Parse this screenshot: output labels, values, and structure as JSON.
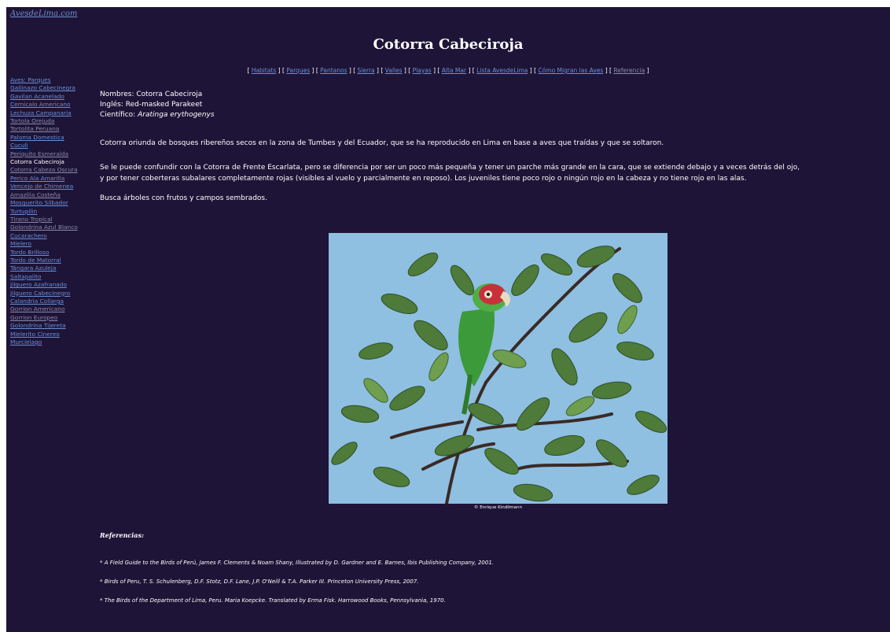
{
  "site": {
    "name": "AvesdeLima.com"
  },
  "page": {
    "title": "Cotorra Cabeciroja"
  },
  "topnav": {
    "open": "[",
    "close": "]",
    "links": [
      "Habitats",
      "Parques",
      "Pantanos",
      "Sierra",
      "Valles",
      "Playas",
      "Alta Mar",
      "Lista AvesdeLima",
      "Cómo Migran las Aves",
      "Referencia"
    ]
  },
  "sidebar": {
    "header": "Aves: Parques",
    "items": [
      "Gallinazo Cabecinegra",
      "Gavilan Acanelado",
      "Cernicalo Americano",
      "Lechuza Campanaria",
      "Tortola Orejuda",
      "Tortolita Peruana",
      "Paloma Domestica",
      "Cuculi",
      "Periquito Esmeralda",
      "Cotorra Cabeciroja",
      "Cotorra Cabeza Oscura",
      "Perico Ala Amarilla",
      "Vencejo de Chimenea",
      "Amazilia Costeña",
      "Mosquerito Silbador",
      "Turtupilin",
      "Tirano Tropical",
      "Golondrina Azul Blanco",
      "Cucarachero",
      "Mielero",
      "Tordo Brilloso",
      "Tordo de Matorral",
      "Tángara Azuleja",
      "Saltapalito",
      "Jilguero Azafranado",
      "Jilguero Cabecinegro",
      "Calandria Collarga",
      "Gorrion Americano",
      "Gorrion Europeo",
      "Golondrina Tijereta",
      "Mielerito Cinereo",
      "Murcielago"
    ],
    "current": "Cotorra Cabeciroja"
  },
  "content": {
    "names_label": "Nombres:",
    "names_value": "Cotorra Cabeciroja",
    "english_label": "Inglés:",
    "english_value": "Red-masked Parakeet",
    "scientific_label": "Científico:",
    "scientific_value": "Aratinga erythogenys",
    "intro": "Cotorra oriunda de bosques ribereños secos en la zona de Tumbes y del Ecuador, que se ha reproducido en Lima en base a aves que traídas y que se soltaron.",
    "compare_line1": "Se le puede confundir con la Cotorra de Frente Escarlata, pero se diferencia por ser un poco más pequeña y tener un parche más grande en la cara, que se extiende debajo y a veces detrás del ojo,",
    "compare_line2": "y por tener coberteras subalares completamente rojas (visibles al vuelo y parcialmente en reposo).   Los juveniles tiene poco rojo o ningún rojo en la cabeza y no tiene rojo en las alas.",
    "habits": "Busca árboles con frutos y campos sembrados.",
    "photo_credit": "© Enrique Kindlimann"
  },
  "references": {
    "title": "Referencias:",
    "items": [
      "* A Field Guide to the Birds of Perú, James F. Clements & Noam Shany, Illustrated by D. Gardner and E. Barnes, Ibis Publishing Company, 2001.",
      "* Birds of Peru, T. S. Schulenberg, D.F. Stotz, D.F. Lane, J.P. O'Neill & T.A. Parker III.  Princeton University Press, 2007.",
      "* The Birds of the Department of Lima, Peru.  Maria Koepcke. Translated by Erma Fisk. Harrowood Books, Pennsylvania, 1970."
    ]
  },
  "colors": {
    "background": "#1e1437",
    "link": "#6a8fd6",
    "visited": "#8a8aa8",
    "text": "#ffffff",
    "sky": "#8ebfe0"
  },
  "icons": {
    "photo": "red-masked-parakeet-photo"
  }
}
